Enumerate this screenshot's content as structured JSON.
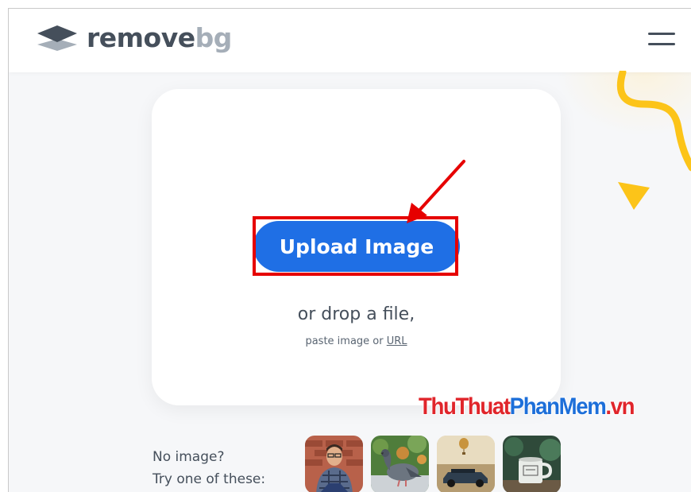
{
  "header": {
    "logo_remove": "remove",
    "logo_bg": "bg",
    "logo_icon": "layers-logo-icon",
    "menu_icon": "hamburger-menu-icon"
  },
  "upload": {
    "button_label": "Upload Image",
    "drop_text": "or drop a file,",
    "paste_prefix": "paste image or ",
    "url_link": "URL"
  },
  "samples": {
    "line1": "No image?",
    "line2": "Try one of these:",
    "images": [
      "sample-person",
      "sample-pigeon",
      "sample-car",
      "sample-mug"
    ]
  },
  "watermark": {
    "part1": "ThuThuat",
    "part2": "PhanMem",
    "part3": ".vn"
  },
  "colors": {
    "accent": "#1f6fe5",
    "highlight": "#e60000",
    "deco": "#fcc419"
  }
}
